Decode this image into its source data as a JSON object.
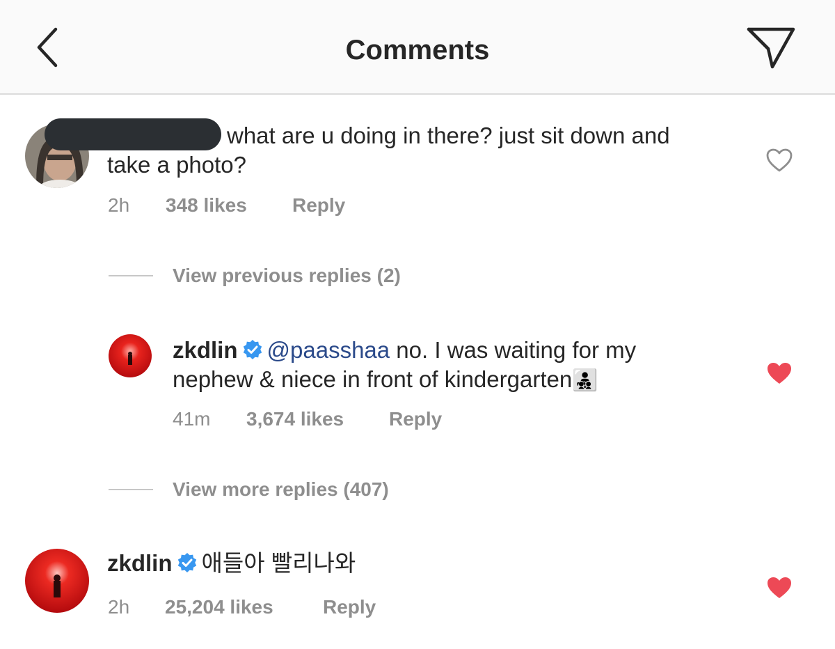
{
  "header": {
    "title": "Comments",
    "back_icon": "chevron-left-icon",
    "share_icon": "paper-plane-icon"
  },
  "comments": [
    {
      "text_line1": "what are u doing in there? just sit down and",
      "text_line2": "take a photo?",
      "time": "2h",
      "likes": "348 likes",
      "reply": "Reply",
      "liked": false,
      "username_redacted": true
    },
    {
      "username": "zkdlin",
      "mention": "@paasshaa",
      "text_line1_rest": " no. I was waiting for my",
      "text_line2": "nephew & niece in front of kindergarten",
      "emoji": "👨‍👧‍👦",
      "time": "41m",
      "likes": "3,674 likes",
      "reply": "Reply",
      "liked": true,
      "verified": true
    },
    {
      "username": "zkdlin",
      "text": "애들아 빨리나와",
      "time": "2h",
      "likes": "25,204 likes",
      "reply": "Reply",
      "liked": true,
      "verified": true
    }
  ],
  "view_previous": "View previous replies (2)",
  "view_more": "View more replies (407)",
  "colors": {
    "liked_heart": "#ed4956",
    "verified": "#3897f0",
    "muted": "#8e8e8e",
    "mention": "#2b4a8a",
    "avatar_red": "#d20f12"
  }
}
